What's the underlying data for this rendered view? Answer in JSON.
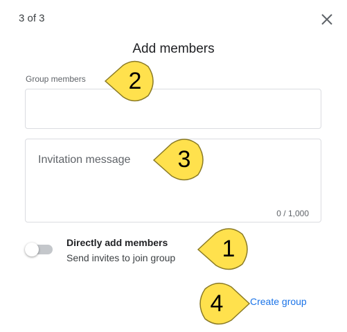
{
  "header": {
    "step_counter": "3 of 3",
    "title": "Add members",
    "close_icon": "close-icon"
  },
  "form": {
    "group_members_label": "Group members",
    "group_members_value": "",
    "invitation_placeholder": "Invitation message",
    "char_counter": "0 / 1,000"
  },
  "toggle": {
    "title": "Directly add members",
    "subtitle": "Send invites to join group",
    "state": "off"
  },
  "footer": {
    "create_label": "Create group"
  },
  "callouts": [
    {
      "label": "1"
    },
    {
      "label": "2"
    },
    {
      "label": "3"
    },
    {
      "label": "4"
    }
  ],
  "colors": {
    "accent": "#1a73e8",
    "callout_fill": "#ffe14d",
    "border": "#dadce0"
  }
}
